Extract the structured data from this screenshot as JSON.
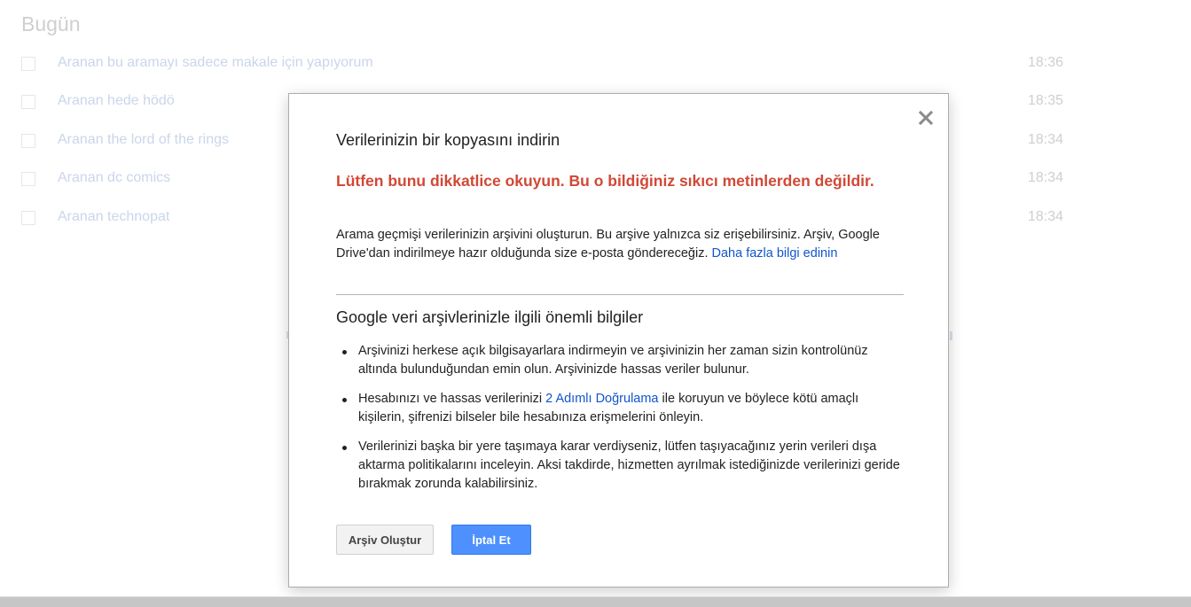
{
  "background": {
    "section_title": "Bugün",
    "rows": [
      {
        "text": "Aranan bu aramayı sadece makale için yapıyorum",
        "time": "18:36"
      },
      {
        "text": "Aranan hede hödö",
        "time": "18:35"
      },
      {
        "text": "Aranan the lord of the rings",
        "time": "18:34"
      },
      {
        "text": "Aranan dc comics",
        "time": "18:34"
      },
      {
        "text": "Aranan technopat",
        "time": "18:34"
      }
    ]
  },
  "dialog": {
    "title": "Verilerinizin bir kopyasını indirin",
    "warning": "Lütfen bunu dikkatlice okuyun. Bu o bildiğiniz sıkıcı metinlerden değildir.",
    "intro_text": "Arama geçmişi verilerinizin arşivini oluşturun. Bu arşive yalnızca siz erişebilirsiniz. Arşiv, Google Drive'dan indirilmeye hazır olduğunda size e-posta göndereceğiz.",
    "learn_more_link": "Daha fazla bilgi edinin",
    "section_title": "Google veri arşivlerinizle ilgili önemli bilgiler",
    "bullet_1": "Arşivinizi herkese açık bilgisayarlara indirmeyin ve arşivinizin her zaman sizin kontrolünüz altında bulunduğundan emin olun. Arşivinizde hassas veriler bulunur.",
    "bullet_2_before": "Hesabınızı ve hassas verilerinizi",
    "bullet_2_link": "2 Adımlı Doğrulama",
    "bullet_2_after": "ile koruyun ve böylece kötü amaçlı kişilerin, şifrenizi bilseler bile hesabınıza erişmelerini önleyin.",
    "bullet_3": "Verilerinizi başka bir yere taşımaya karar verdiyseniz, lütfen taşıyacağınız yerin verileri dışa aktarma politikalarını inceleyin. Aksi takdirde, hizmetten ayrılmak istediğinizde verilerinizi geride bırakmak zorunda kalabilirsiniz.",
    "create_button": "Arşiv Oluştur",
    "cancel_button": "İptal Et",
    "close_icon": "close-icon"
  },
  "colors": {
    "warning": "#d14836",
    "link": "#1155cc",
    "primary_button": "#4d90fe"
  }
}
